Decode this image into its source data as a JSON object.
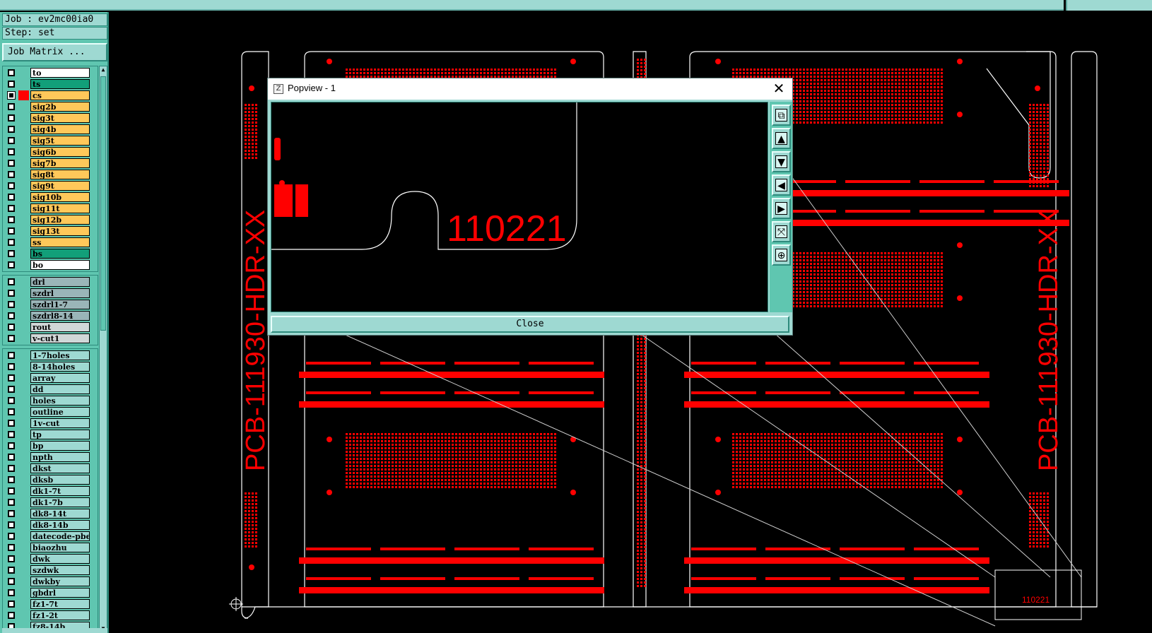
{
  "header": {
    "job": "Job : ev2mc00ia0",
    "step": "Step: set",
    "job_matrix_label": "Job Matrix ..."
  },
  "layer_groups": [
    {
      "name": "board-layers",
      "layers": [
        {
          "name": "to",
          "color": "white"
        },
        {
          "name": "ts",
          "color": "teal"
        },
        {
          "name": "cs",
          "color": "yellow",
          "active": true
        },
        {
          "name": "sig2b",
          "color": "yellow"
        },
        {
          "name": "sig3t",
          "color": "yellow"
        },
        {
          "name": "sig4b",
          "color": "yellow"
        },
        {
          "name": "sig5t",
          "color": "yellow"
        },
        {
          "name": "sig6b",
          "color": "yellow"
        },
        {
          "name": "sig7b",
          "color": "yellow"
        },
        {
          "name": "sig8t",
          "color": "yellow"
        },
        {
          "name": "sig9t",
          "color": "yellow"
        },
        {
          "name": "sig10b",
          "color": "yellow"
        },
        {
          "name": "sig11t",
          "color": "yellow"
        },
        {
          "name": "sig12b",
          "color": "yellow"
        },
        {
          "name": "sig13t",
          "color": "yellow"
        },
        {
          "name": "ss",
          "color": "yellow"
        },
        {
          "name": "bs",
          "color": "teal"
        },
        {
          "name": "bo",
          "color": "white"
        }
      ]
    },
    {
      "name": "drill-layers",
      "layers": [
        {
          "name": "drl",
          "color": "gray"
        },
        {
          "name": "szdrl",
          "color": "gray"
        },
        {
          "name": "szdrl1-7",
          "color": "gray"
        },
        {
          "name": "szdrl8-14",
          "color": "gray"
        },
        {
          "name": "rout",
          "color": "lightgray"
        },
        {
          "name": "v-cut1",
          "color": "lightgray"
        }
      ]
    },
    {
      "name": "misc-layers",
      "layers": [
        {
          "name": "1-7holes",
          "color": "cyan"
        },
        {
          "name": "8-14holes",
          "color": "cyan"
        },
        {
          "name": "array",
          "color": "cyan"
        },
        {
          "name": "dd",
          "color": "cyan"
        },
        {
          "name": "holes",
          "color": "cyan"
        },
        {
          "name": "outline",
          "color": "cyan"
        },
        {
          "name": "1v-cut",
          "color": "cyan"
        },
        {
          "name": "tp",
          "color": "cyan"
        },
        {
          "name": "bp",
          "color": "cyan"
        },
        {
          "name": "npth",
          "color": "cyan"
        },
        {
          "name": "dkst",
          "color": "cyan"
        },
        {
          "name": "dksb",
          "color": "cyan"
        },
        {
          "name": "dk1-7t",
          "color": "cyan"
        },
        {
          "name": "dk1-7b",
          "color": "cyan"
        },
        {
          "name": "dk8-14t",
          "color": "cyan"
        },
        {
          "name": "dk8-14b",
          "color": "cyan"
        },
        {
          "name": "datecode-pbe",
          "color": "cyan"
        },
        {
          "name": "biaozhu",
          "color": "cyan"
        },
        {
          "name": "dwk",
          "color": "cyan"
        },
        {
          "name": "szdwk",
          "color": "cyan"
        },
        {
          "name": "dwkby",
          "color": "cyan"
        },
        {
          "name": "gbdrl",
          "color": "cyan"
        },
        {
          "name": "fz1-7t",
          "color": "cyan"
        },
        {
          "name": "fz1-2t",
          "color": "cyan"
        },
        {
          "name": "fz8-14b",
          "color": "cyan"
        }
      ]
    }
  ],
  "canvas": {
    "board_text_left": "PCB-111930-HDR-XX",
    "board_text_right": "PCB-111930-HDR-XX",
    "zoom_box_text": "110221"
  },
  "popup": {
    "title": "Popview - 1",
    "close_x": "✕",
    "view_text": "110221",
    "close_label": "Close",
    "tools": [
      {
        "name": "zoom-window-icon",
        "glyph": "⧉"
      },
      {
        "name": "pan-up-icon",
        "glyph": "▲"
      },
      {
        "name": "pan-down-icon",
        "glyph": "▼"
      },
      {
        "name": "pan-left-icon",
        "glyph": "◀"
      },
      {
        "name": "pan-right-icon",
        "glyph": "▶"
      },
      {
        "name": "zoom-fit-icon",
        "glyph": "⤧"
      },
      {
        "name": "zoom-center-icon",
        "glyph": "⊕"
      }
    ]
  },
  "colors": {
    "panel": "#5fc6b0",
    "panel_light": "#9ed9d2",
    "copper": "#ff0000",
    "outline": "#ffffff"
  }
}
